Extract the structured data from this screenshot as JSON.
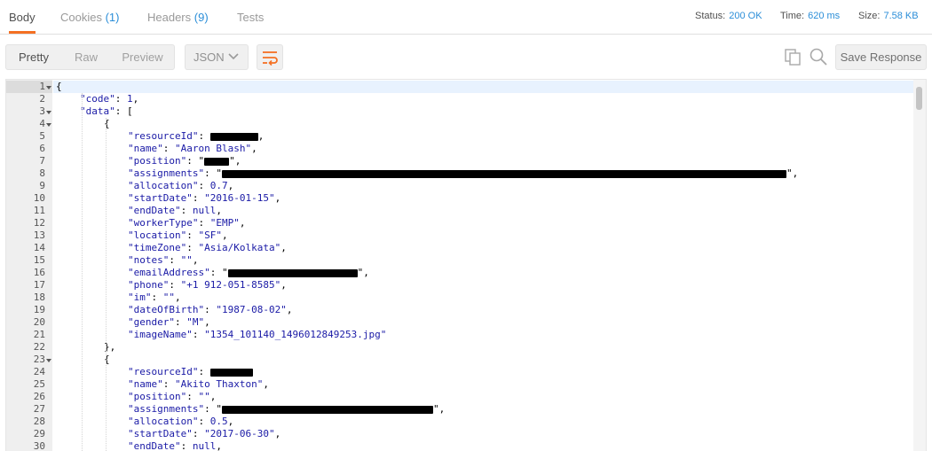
{
  "tabs": [
    {
      "label": "Body",
      "count": ""
    },
    {
      "label": "Cookies",
      "count": "(1)"
    },
    {
      "label": "Headers",
      "count": "(9)"
    },
    {
      "label": "Tests",
      "count": ""
    }
  ],
  "status": {
    "status_label": "Status:",
    "status_value": "200 OK",
    "time_label": "Time:",
    "time_value": "620 ms",
    "size_label": "Size:",
    "size_value": "7.58 KB"
  },
  "toolbar": {
    "view_modes": [
      "Pretty",
      "Raw",
      "Preview"
    ],
    "active_view": "Pretty",
    "format": "JSON",
    "save_label": "Save Response"
  },
  "icons": {
    "wrap": "wrap-lines-icon",
    "copy": "copy-icon",
    "search": "search-icon",
    "format_dropdown": "chevron-down-icon",
    "fold": "fold-arrow-icon"
  },
  "colors": {
    "accent": "#f47023",
    "link": "#2b8ed8",
    "json_value": "#1a1aa6"
  },
  "code_lines": [
    {
      "n": "1",
      "fold": true,
      "indent": 0,
      "parts": [
        [
          "p",
          "{"
        ]
      ]
    },
    {
      "n": "2",
      "fold": false,
      "indent": 1,
      "parts": [
        [
          "k",
          "\"code\""
        ],
        [
          "p",
          ": "
        ],
        [
          "s",
          "1"
        ],
        [
          "p",
          ","
        ]
      ]
    },
    {
      "n": "3",
      "fold": true,
      "indent": 1,
      "parts": [
        [
          "k",
          "\"data\""
        ],
        [
          "p",
          ": ["
        ]
      ]
    },
    {
      "n": "4",
      "fold": true,
      "indent": 2,
      "parts": [
        [
          "p",
          "{"
        ]
      ]
    },
    {
      "n": "5",
      "fold": false,
      "indent": 3,
      "parts": [
        [
          "k",
          "\"resourceId\""
        ],
        [
          "p",
          ": "
        ],
        [
          "r",
          "54"
        ],
        [
          "p",
          ","
        ]
      ]
    },
    {
      "n": "6",
      "fold": false,
      "indent": 3,
      "parts": [
        [
          "k",
          "\"name\""
        ],
        [
          "p",
          ": "
        ],
        [
          "s",
          "\"Aaron Blash\""
        ],
        [
          "p",
          ","
        ]
      ]
    },
    {
      "n": "7",
      "fold": false,
      "indent": 3,
      "parts": [
        [
          "k",
          "\"position\""
        ],
        [
          "p",
          ": \""
        ],
        [
          "r",
          "28"
        ],
        [
          "p",
          "\","
        ]
      ]
    },
    {
      "n": "8",
      "fold": false,
      "indent": 3,
      "parts": [
        [
          "k",
          "\"assignments\""
        ],
        [
          "p",
          ": \""
        ],
        [
          "r",
          "636"
        ],
        [
          "p",
          "\","
        ]
      ]
    },
    {
      "n": "9",
      "fold": false,
      "indent": 3,
      "parts": [
        [
          "k",
          "\"allocation\""
        ],
        [
          "p",
          ": "
        ],
        [
          "s",
          "0.7"
        ],
        [
          "p",
          ","
        ]
      ]
    },
    {
      "n": "10",
      "fold": false,
      "indent": 3,
      "parts": [
        [
          "k",
          "\"startDate\""
        ],
        [
          "p",
          ": "
        ],
        [
          "s",
          "\"2016-01-15\""
        ],
        [
          "p",
          ","
        ]
      ]
    },
    {
      "n": "11",
      "fold": false,
      "indent": 3,
      "parts": [
        [
          "k",
          "\"endDate\""
        ],
        [
          "p",
          ": "
        ],
        [
          "s",
          "null"
        ],
        [
          "p",
          ","
        ]
      ]
    },
    {
      "n": "12",
      "fold": false,
      "indent": 3,
      "parts": [
        [
          "k",
          "\"workerType\""
        ],
        [
          "p",
          ": "
        ],
        [
          "s",
          "\"EMP\""
        ],
        [
          "p",
          ","
        ]
      ]
    },
    {
      "n": "13",
      "fold": false,
      "indent": 3,
      "parts": [
        [
          "k",
          "\"location\""
        ],
        [
          "p",
          ": "
        ],
        [
          "s",
          "\"SF\""
        ],
        [
          "p",
          ","
        ]
      ]
    },
    {
      "n": "14",
      "fold": false,
      "indent": 3,
      "parts": [
        [
          "k",
          "\"timeZone\""
        ],
        [
          "p",
          ": "
        ],
        [
          "s",
          "\"Asia/Kolkata\""
        ],
        [
          "p",
          ","
        ]
      ]
    },
    {
      "n": "15",
      "fold": false,
      "indent": 3,
      "parts": [
        [
          "k",
          "\"notes\""
        ],
        [
          "p",
          ": "
        ],
        [
          "s",
          "\"\""
        ],
        [
          "p",
          ","
        ]
      ]
    },
    {
      "n": "16",
      "fold": false,
      "indent": 3,
      "parts": [
        [
          "k",
          "\"emailAddress\""
        ],
        [
          "p",
          ": \""
        ],
        [
          "r",
          "146"
        ],
        [
          "p",
          "\","
        ]
      ]
    },
    {
      "n": "17",
      "fold": false,
      "indent": 3,
      "parts": [
        [
          "k",
          "\"phone\""
        ],
        [
          "p",
          ": "
        ],
        [
          "s",
          "\"+1 912-051-8585\""
        ],
        [
          "p",
          ","
        ]
      ]
    },
    {
      "n": "18",
      "fold": false,
      "indent": 3,
      "parts": [
        [
          "k",
          "\"im\""
        ],
        [
          "p",
          ": "
        ],
        [
          "s",
          "\"\""
        ],
        [
          "p",
          ","
        ]
      ]
    },
    {
      "n": "19",
      "fold": false,
      "indent": 3,
      "parts": [
        [
          "k",
          "\"dateOfBirth\""
        ],
        [
          "p",
          ": "
        ],
        [
          "s",
          "\"1987-08-02\""
        ],
        [
          "p",
          ","
        ]
      ]
    },
    {
      "n": "20",
      "fold": false,
      "indent": 3,
      "parts": [
        [
          "k",
          "\"gender\""
        ],
        [
          "p",
          ": "
        ],
        [
          "s",
          "\"M\""
        ],
        [
          "p",
          ","
        ]
      ]
    },
    {
      "n": "21",
      "fold": false,
      "indent": 3,
      "parts": [
        [
          "k",
          "\"imageName\""
        ],
        [
          "p",
          ": "
        ],
        [
          "s",
          "\"1354_101140_1496012849253.jpg\""
        ]
      ]
    },
    {
      "n": "22",
      "fold": false,
      "indent": 2,
      "parts": [
        [
          "p",
          "},"
        ]
      ]
    },
    {
      "n": "23",
      "fold": true,
      "indent": 2,
      "parts": [
        [
          "p",
          "{"
        ]
      ]
    },
    {
      "n": "24",
      "fold": false,
      "indent": 3,
      "parts": [
        [
          "k",
          "\"resourceId\""
        ],
        [
          "p",
          ": "
        ],
        [
          "r",
          "48"
        ]
      ]
    },
    {
      "n": "25",
      "fold": false,
      "indent": 3,
      "parts": [
        [
          "k",
          "\"name\""
        ],
        [
          "p",
          ": "
        ],
        [
          "s",
          "\"Akito Thaxton\""
        ],
        [
          "p",
          ","
        ]
      ]
    },
    {
      "n": "26",
      "fold": false,
      "indent": 3,
      "parts": [
        [
          "k",
          "\"position\""
        ],
        [
          "p",
          ": "
        ],
        [
          "s",
          "\"\""
        ],
        [
          "p",
          ","
        ]
      ]
    },
    {
      "n": "27",
      "fold": false,
      "indent": 3,
      "parts": [
        [
          "k",
          "\"assignments\""
        ],
        [
          "p",
          ": \""
        ],
        [
          "r",
          "238"
        ],
        [
          "p",
          "\","
        ]
      ]
    },
    {
      "n": "28",
      "fold": false,
      "indent": 3,
      "parts": [
        [
          "k",
          "\"allocation\""
        ],
        [
          "p",
          ": "
        ],
        [
          "s",
          "0.5"
        ],
        [
          "p",
          ","
        ]
      ]
    },
    {
      "n": "29",
      "fold": false,
      "indent": 3,
      "parts": [
        [
          "k",
          "\"startDate\""
        ],
        [
          "p",
          ": "
        ],
        [
          "s",
          "\"2017-06-30\""
        ],
        [
          "p",
          ","
        ]
      ]
    },
    {
      "n": "30",
      "fold": false,
      "indent": 3,
      "parts": [
        [
          "k",
          "\"endDate\""
        ],
        [
          "p",
          ": "
        ],
        [
          "s",
          "null"
        ],
        [
          "p",
          ","
        ]
      ]
    }
  ]
}
